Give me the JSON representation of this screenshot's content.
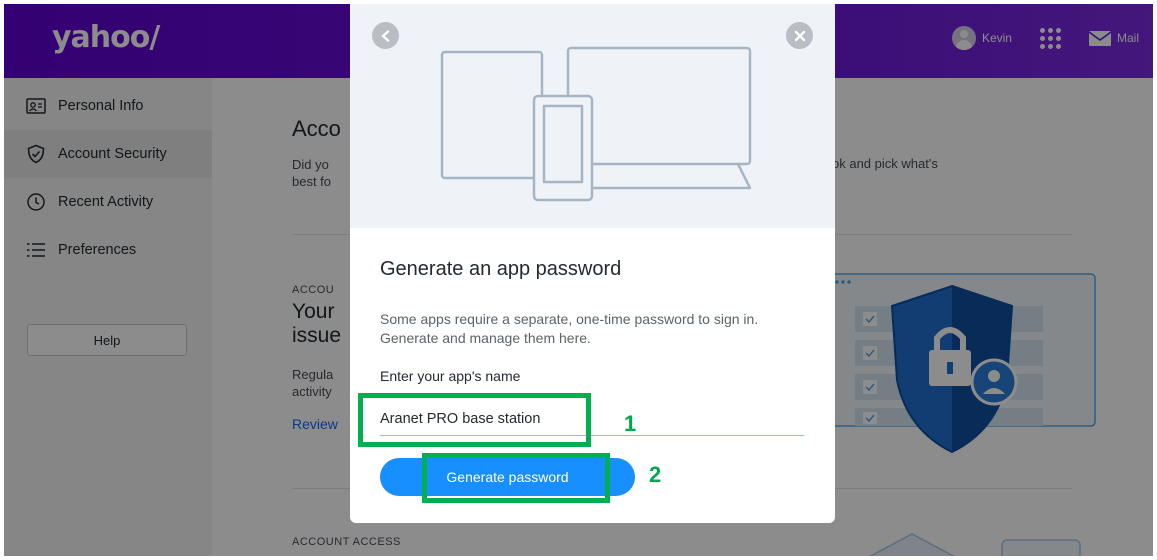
{
  "header": {
    "logo": "yahoo/",
    "user_name": "Kevin",
    "mail_label": "Mail"
  },
  "sidebar": {
    "items": [
      {
        "label": "Personal Info",
        "icon": "id-card-icon"
      },
      {
        "label": "Account Security",
        "icon": "shield-icon"
      },
      {
        "label": "Recent Activity",
        "icon": "clock-icon"
      },
      {
        "label": "Preferences",
        "icon": "list-icon"
      }
    ],
    "help_label": "Help"
  },
  "main": {
    "title": "Acco",
    "desc_left": "Did yo",
    "desc_left_2": "best fo",
    "desc_right": "ok and pick what's",
    "section1_label": "ACCOU",
    "heading_line1": "Your",
    "heading_line2": "issue",
    "body_line1": "Regula",
    "body_line2": "activity",
    "review_link": "Review",
    "section2_label": "ACCOUNT ACCESS"
  },
  "modal": {
    "title": "Generate an app password",
    "description": "Some apps require a separate, one-time password to sign in. Generate and manage them here.",
    "field_label": "Enter your app's name",
    "app_name_value": "Aranet PRO base station",
    "generate_button": "Generate password"
  },
  "annotations": {
    "step1": "1",
    "step2": "2",
    "highlight_color": "#00b050"
  },
  "colors": {
    "brand": "#6001d2",
    "button": "#188fff",
    "link": "#0f69ff"
  }
}
